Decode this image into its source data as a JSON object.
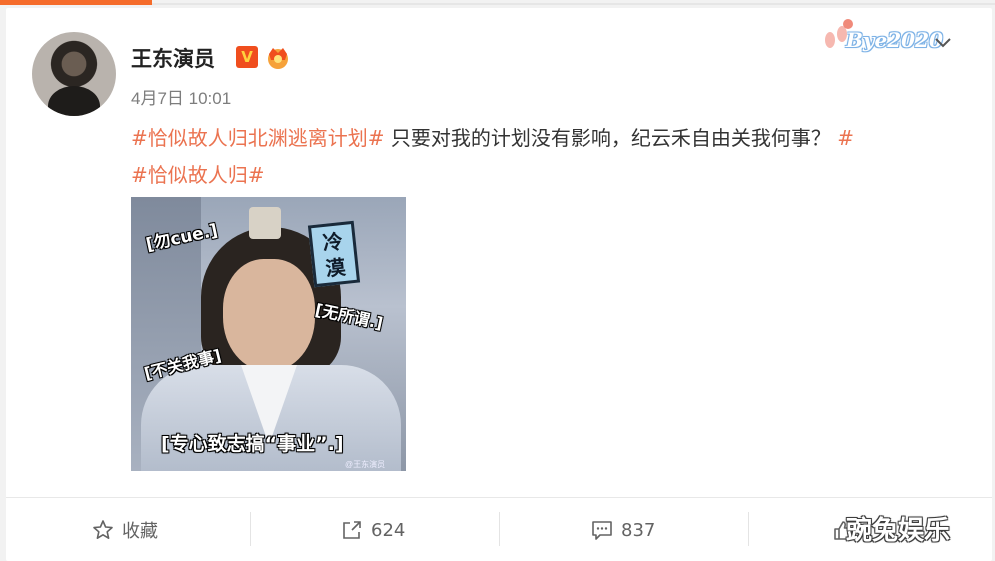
{
  "post": {
    "author_name": "王东演员",
    "verified_badge": "V",
    "timestamp": "4月7日 10:01",
    "hashtag_1": "#恰似故人归北渊逃离计划#",
    "body_text": " 只要对我的计划没有影响，纪云禾自由关我何事？",
    "hashtag_2": "#恰似故人归#"
  },
  "media": {
    "label_1": "[勿cue.]",
    "label_2": "[无所谓.]",
    "label_3": "[不关我事]",
    "label_4": "[专心致志搞“事业”.]",
    "stamp_line_1": "冷",
    "stamp_line_2": "漠",
    "credit": "@王东演员"
  },
  "actions": {
    "favorite_label": "收藏",
    "share_count": "624",
    "comment_count": "837",
    "like_count": ""
  },
  "watermarks": {
    "top_right": "Bye2020",
    "bottom_right": "豌兔娱乐"
  },
  "colors": {
    "hashtag": "#eb7350",
    "accent": "#f56c2b",
    "verified": "#f04e1e"
  },
  "icons": {
    "favorite": "star-icon",
    "share": "share-icon",
    "comment": "comment-icon",
    "like": "thumbs-up-icon",
    "menu": "chevron-down-icon"
  }
}
